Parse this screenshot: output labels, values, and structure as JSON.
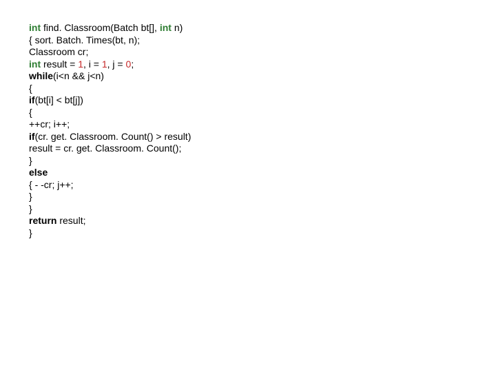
{
  "code": {
    "l1": {
      "t1": "int",
      "t2": " find. Classroom(Batch bt[], ",
      "t3": "int",
      "t4": " n)"
    },
    "l2": "{ sort. Batch. Times(bt, n);",
    "l3": "Classroom cr;",
    "l4": {
      "t1": "int",
      "t2": " result = ",
      "n1": "1",
      "t3": ", i = ",
      "n2": "1",
      "t4": ", j = ",
      "n3": "0",
      "t5": ";"
    },
    "l5": {
      "k1": "while",
      "t1": "(i<n && j<n)"
    },
    "l6": "{",
    "l7": {
      "k1": "if",
      "t1": "(bt[i] < bt[j])"
    },
    "l8": "{",
    "l9": "++cr; i++;",
    "l10": {
      "k1": "if",
      "t1": "(cr. get. Classroom. Count() > result)"
    },
    "l11": "result = cr. get. Classroom. Count();",
    "l12": "}",
    "l13": {
      "k1": "else"
    },
    "l14": "{ - -cr; j++;",
    "l15": "}",
    "l16": "}",
    "l17": {
      "k1": "return",
      "t1": " result;"
    },
    "l18": "}"
  }
}
